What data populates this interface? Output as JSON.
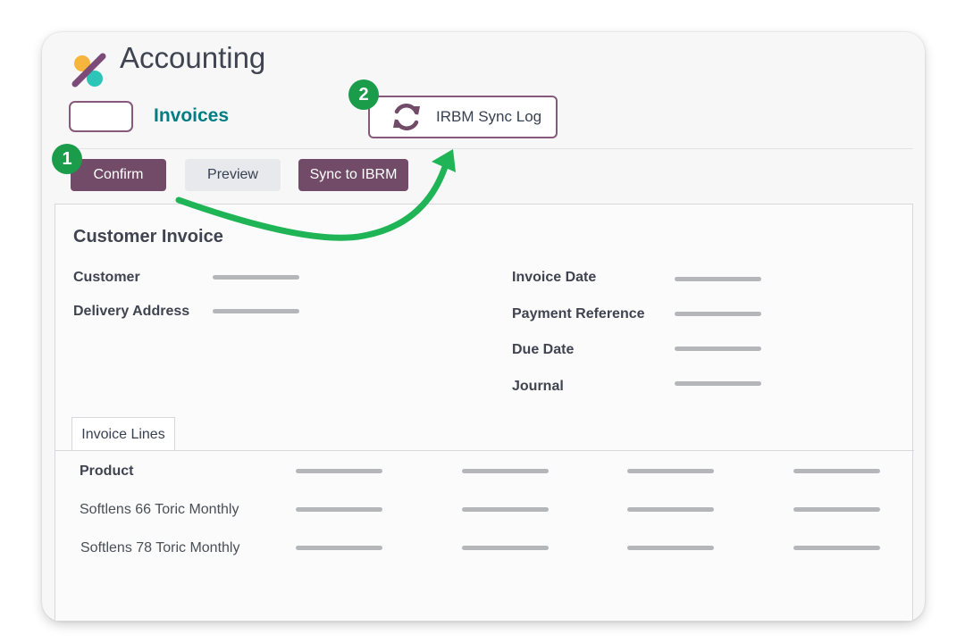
{
  "header": {
    "app_title": "Accounting",
    "breadcrumb": "Invoices",
    "sync_log_label": "IRBM Sync Log"
  },
  "toolbar": {
    "confirm_label": "Confirm",
    "preview_label": "Preview",
    "sync_label": "Sync to IBRM"
  },
  "steps": [
    "1",
    "2"
  ],
  "form": {
    "title": "Customer Invoice",
    "left_fields": [
      "Customer",
      "Delivery Address"
    ],
    "right_fields": [
      "Invoice Date",
      "Payment Reference",
      "Due Date",
      "Journal"
    ]
  },
  "tabs": [
    "Invoice Lines"
  ],
  "lines": {
    "header": "Product",
    "rows": [
      "Softlens 66 Toric Monthly",
      "Softlens 78 Toric Monthly"
    ]
  },
  "colors": {
    "primary": "#714b67",
    "accent": "#017e84",
    "step_badge": "#1a9c4b",
    "arrow": "#1fb455"
  },
  "icons": {
    "logo": "odoo-accounting-logo",
    "sync": "sync-icon"
  }
}
